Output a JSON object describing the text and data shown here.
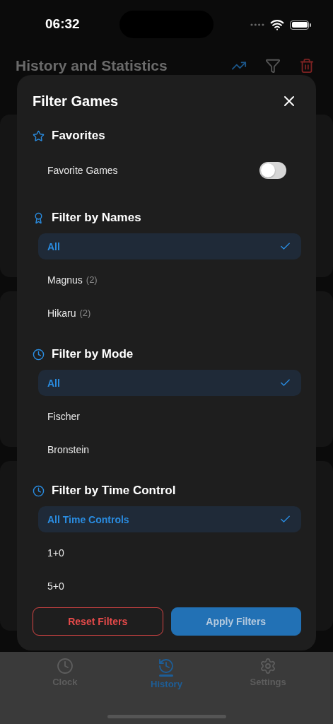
{
  "status_bar": {
    "time": "06:32"
  },
  "header": {
    "title": "History and Statistics"
  },
  "sheet": {
    "title": "Filter Games",
    "sections": [
      {
        "kind": "toggle",
        "title": "Favorites",
        "label": "Favorite Games",
        "on": false
      },
      {
        "kind": "options",
        "title": "Filter by Names",
        "options": [
          {
            "label": "All",
            "selected": true
          },
          {
            "label": "Magnus",
            "count": "(2)",
            "selected": false
          },
          {
            "label": "Hikaru",
            "count": "(2)",
            "selected": false
          }
        ]
      },
      {
        "kind": "options",
        "title": "Filter by Mode",
        "options": [
          {
            "label": "All",
            "selected": true
          },
          {
            "label": "Fischer",
            "selected": false
          },
          {
            "label": "Bronstein",
            "selected": false
          }
        ]
      },
      {
        "kind": "options",
        "title": "Filter by Time Control",
        "options": [
          {
            "label": "All Time Controls",
            "selected": true
          },
          {
            "label": "1+0",
            "selected": false
          },
          {
            "label": "5+0",
            "selected": false
          }
        ]
      }
    ],
    "buttons": [
      {
        "kind": "reset",
        "label": "Reset Filters"
      },
      {
        "kind": "apply",
        "label": "Apply Filters"
      }
    ]
  },
  "tab_bar": [
    {
      "label": "Clock",
      "selected": false
    },
    {
      "label": "History",
      "selected": true
    },
    {
      "label": "Settings",
      "selected": false
    }
  ]
}
